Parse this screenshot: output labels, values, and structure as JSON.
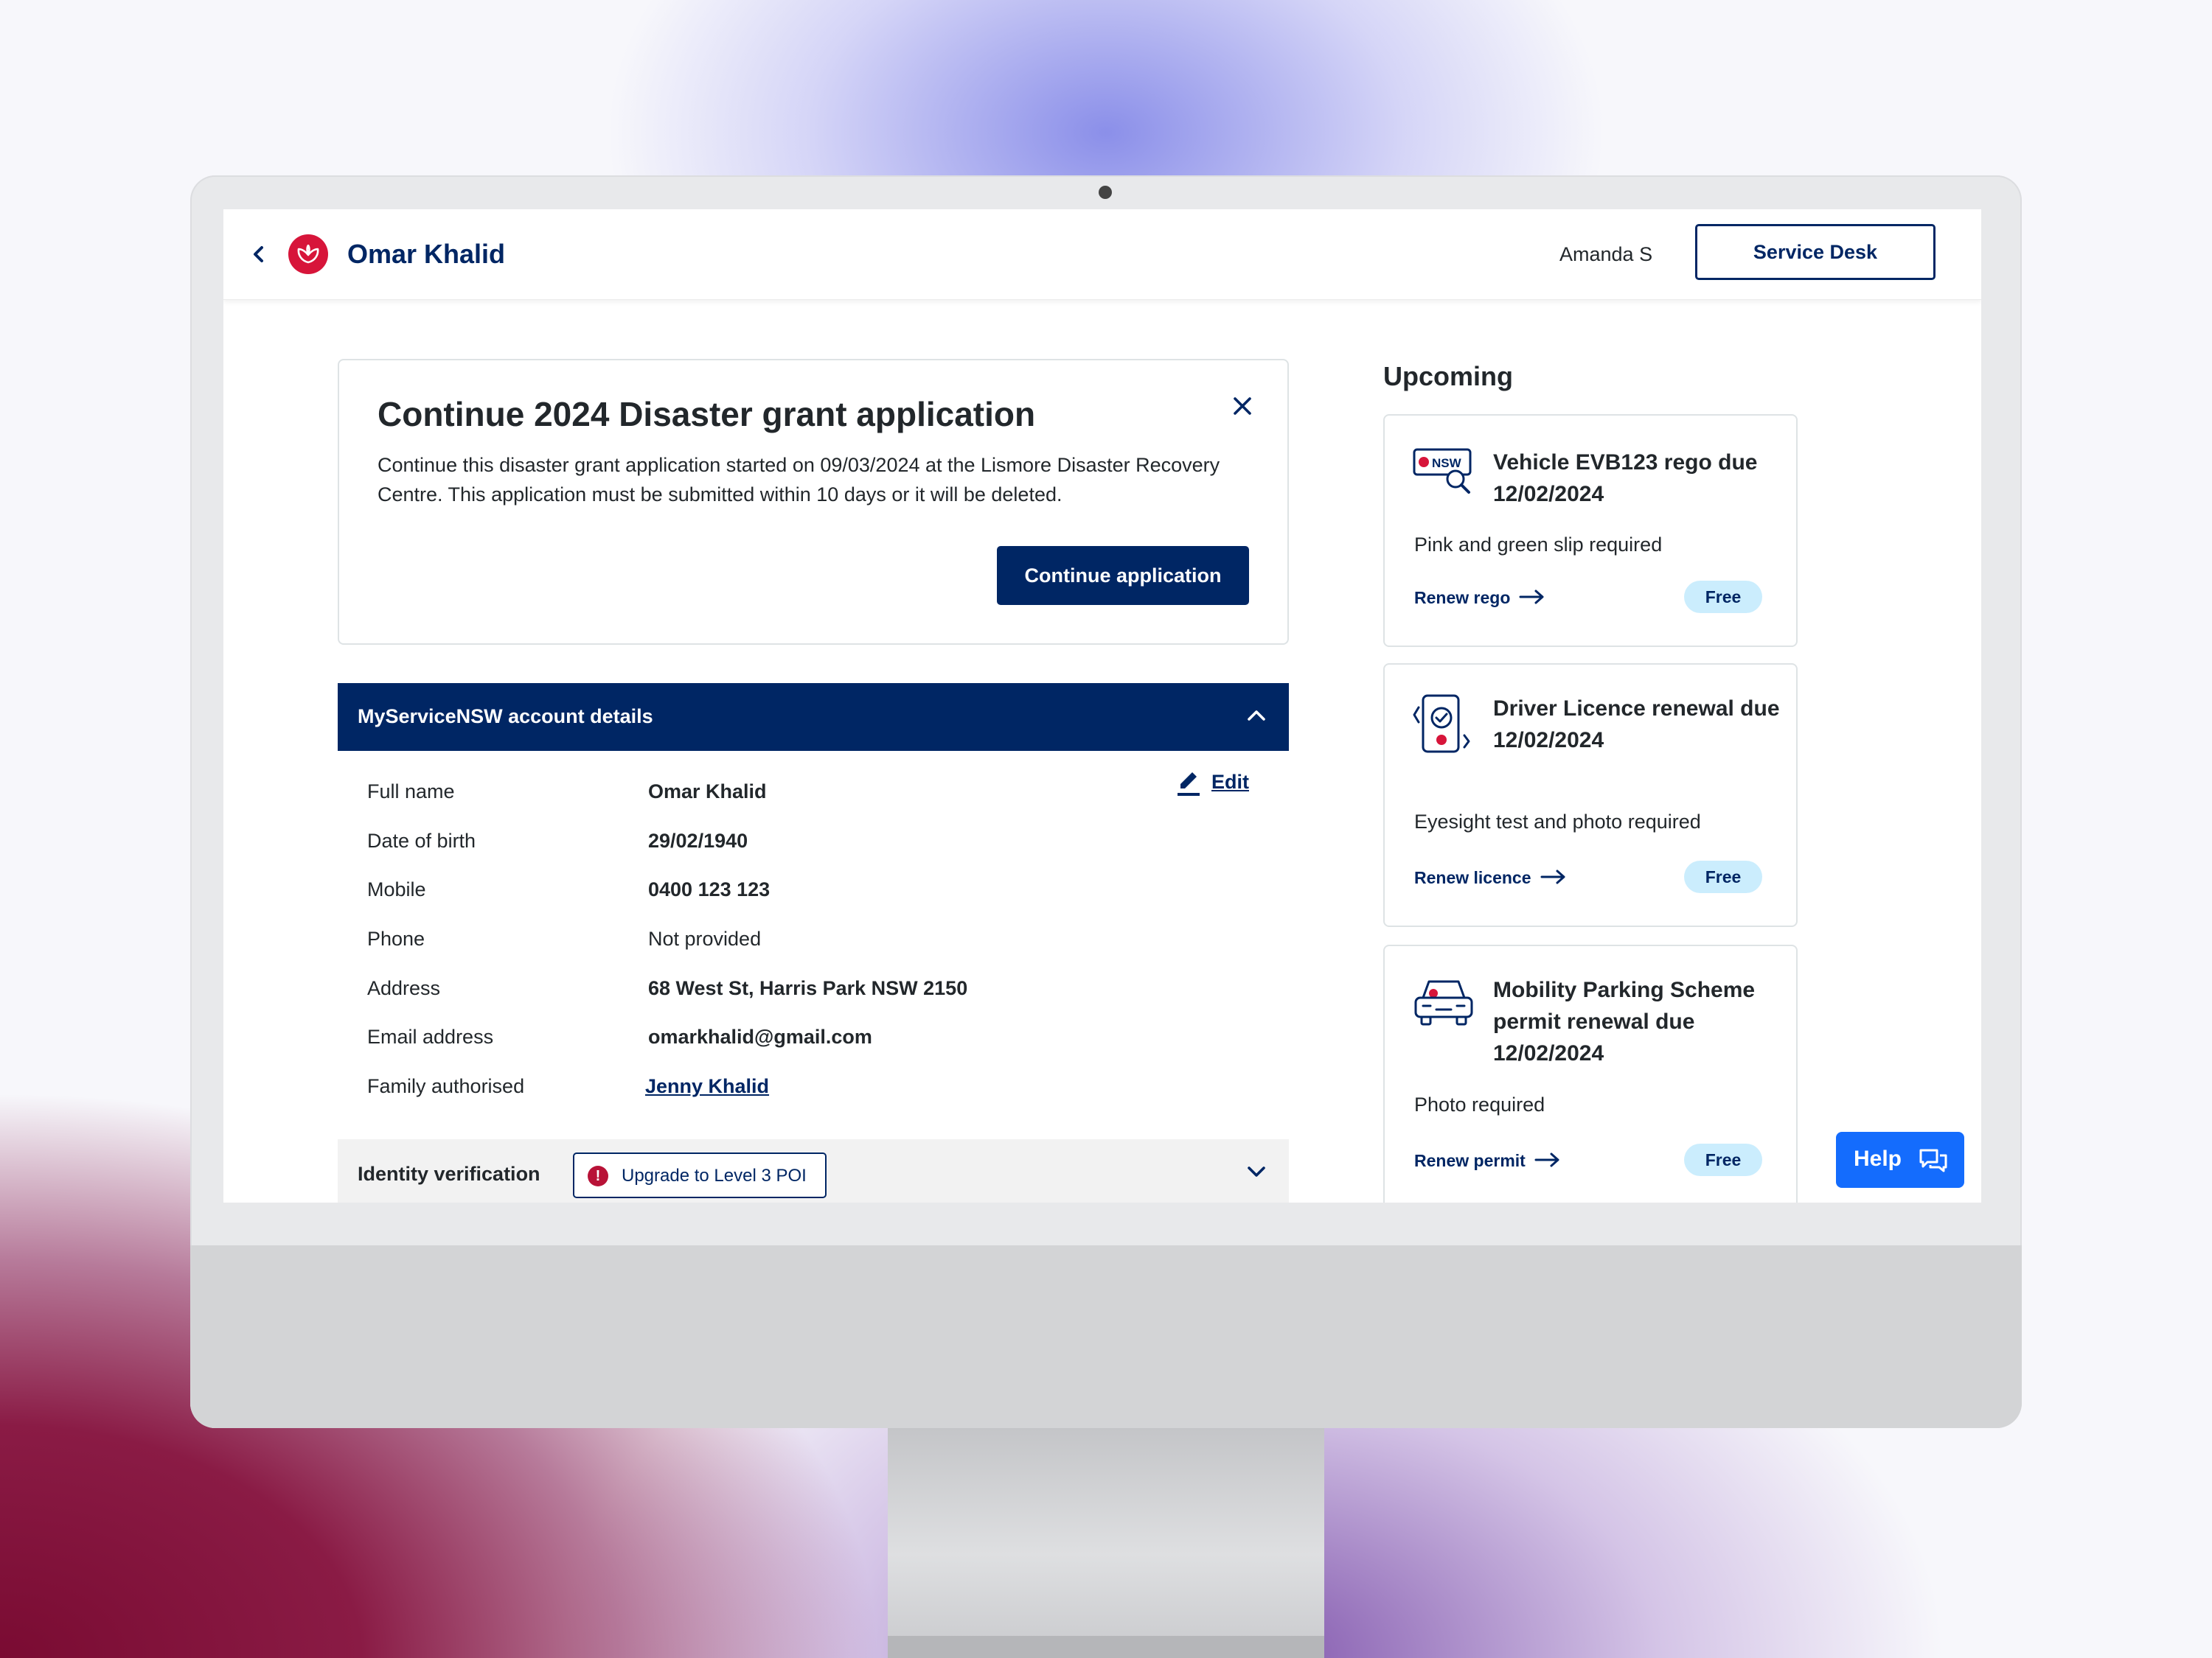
{
  "header": {
    "customer_name": "Omar Khalid",
    "agent_name": "Amanda S",
    "service_desk_label": "Service Desk"
  },
  "grant_card": {
    "title": "Continue 2024 Disaster grant application",
    "description": "Continue this disaster grant application started on 09/03/2024 at the Lismore Disaster Recovery Centre. This application must be submitted within 10 days or it will be deleted.",
    "continue_label": "Continue application"
  },
  "account": {
    "title": "MyServiceNSW account details",
    "edit_label": "Edit",
    "rows": [
      {
        "label": "Full name",
        "value": "Omar Khalid"
      },
      {
        "label": "Date of birth",
        "value": "29/02/1940"
      },
      {
        "label": "Mobile",
        "value": "0400 123 123"
      },
      {
        "label": "Phone",
        "value": "Not provided"
      },
      {
        "label": "Address",
        "value": "68 West St, Harris Park NSW 2150"
      },
      {
        "label": "Email address",
        "value": "omarkhalid@gmail.com"
      },
      {
        "label": "Family authorised",
        "value": "Jenny Khalid"
      }
    ]
  },
  "identity": {
    "label": "Identity verification",
    "badge": "Upgrade to Level 3 POI"
  },
  "upcoming": {
    "title": "Upcoming",
    "cards": [
      {
        "title": "Vehicle EVB123 rego due 12/02/2024",
        "desc": "Pink and green slip required",
        "link": "Renew rego",
        "pill": "Free",
        "icon": "nsw-plate-search-icon"
      },
      {
        "title": "Driver Licence renewal due 12/02/2024",
        "desc": "Eyesight test and photo required",
        "link": "Renew licence",
        "pill": "Free",
        "icon": "licence-card-icon"
      },
      {
        "title": "Mobility Parking Scheme permit renewal due 12/02/2024",
        "desc": "Photo required",
        "link": "Renew permit",
        "pill": "Free",
        "icon": "car-icon"
      }
    ]
  },
  "help": {
    "label": "Help"
  },
  "colors": {
    "navy": "#002664",
    "red": "#d7153a",
    "blue": "#146cfd",
    "pill": "#cbedfd"
  }
}
